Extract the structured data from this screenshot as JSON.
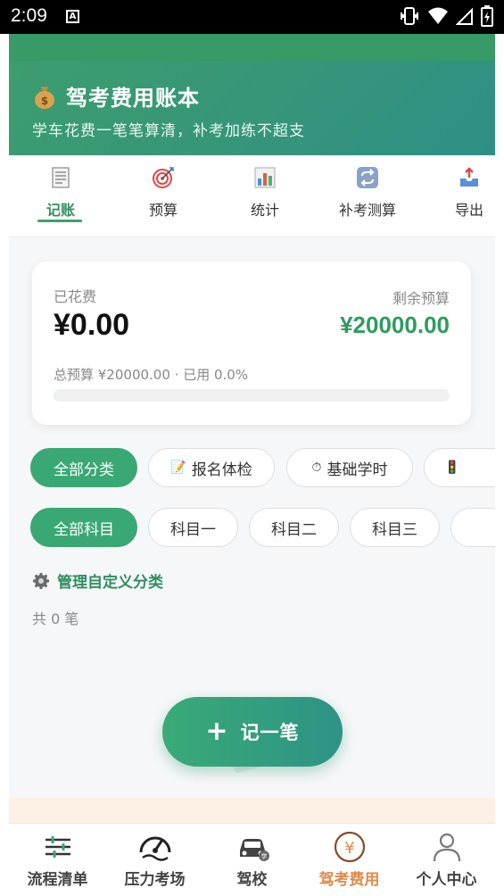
{
  "status_bar": {
    "time": "2:09",
    "notification_letter": "A"
  },
  "header": {
    "title": "驾考费用账本",
    "subtitle": "学车花费一笔笔算清，补考加练不超支",
    "icon": "money-bag-icon"
  },
  "tabs": [
    {
      "label": "记账",
      "icon": "ledger-icon",
      "active": true
    },
    {
      "label": "预算",
      "icon": "target-icon",
      "active": false
    },
    {
      "label": "统计",
      "icon": "bar-chart-icon",
      "active": false
    },
    {
      "label": "补考测算",
      "icon": "repeat-icon",
      "active": false
    },
    {
      "label": "导出",
      "icon": "export-icon",
      "active": false
    }
  ],
  "summary": {
    "spent_label": "已花费",
    "spent_value": "¥0.00",
    "remain_label": "剩余预算",
    "remain_value": "¥20000.00",
    "budget_info": "总预算 ¥20000.00 · 已用 0.0%",
    "used_fraction": 0.0
  },
  "category_chips": [
    {
      "label": "全部分类",
      "active": true
    },
    {
      "label": "报名体检",
      "icon": "memo-icon",
      "emoji": "📝",
      "active": false
    },
    {
      "label": "基础学时",
      "icon": "stopwatch-icon",
      "emoji": "⏱",
      "active": false
    },
    {
      "label": "",
      "icon": "traffic-light-icon",
      "emoji": "🚦",
      "active": false
    }
  ],
  "subject_chips": [
    {
      "label": "全部科目",
      "active": true
    },
    {
      "label": "科目一",
      "active": false
    },
    {
      "label": "科目二",
      "active": false
    },
    {
      "label": "科目三",
      "active": false
    },
    {
      "label": "",
      "active": false
    }
  ],
  "manage_label": "管理自定义分类",
  "record_count": "共 0 笔",
  "fab": {
    "plus": "+",
    "label": "记一笔"
  },
  "bottom_nav": [
    {
      "label": "流程清单",
      "icon": "sliders-icon",
      "active": false
    },
    {
      "label": "压力考场",
      "icon": "speedometer-icon",
      "active": false
    },
    {
      "label": "驾校",
      "icon": "car-school-icon",
      "active": false
    },
    {
      "label": "驾考费用",
      "icon": "yen-coin-icon",
      "active": true
    },
    {
      "label": "个人中心",
      "icon": "person-icon",
      "active": false
    }
  ],
  "colors": {
    "primary": "#3ea06b",
    "accent_orange": "#e08a4a",
    "remain_green": "#2f9b5f"
  }
}
